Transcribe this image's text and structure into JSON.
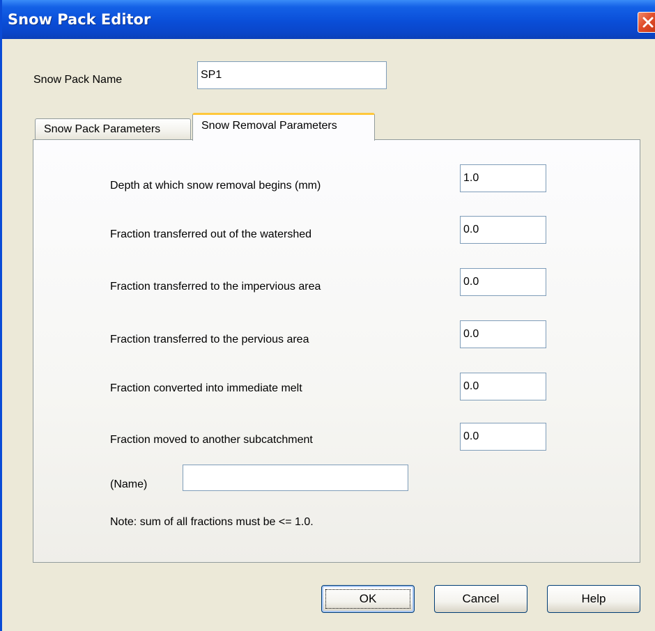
{
  "window": {
    "title": "Snow Pack Editor"
  },
  "snow_pack_name": {
    "label": "Snow Pack Name",
    "value": "SP1"
  },
  "tabs": [
    {
      "label": "Snow Pack Parameters",
      "active": false
    },
    {
      "label": "Snow Removal Parameters",
      "active": true
    }
  ],
  "removal": {
    "fields": [
      {
        "label": "Depth at which snow removal begins (mm)",
        "value": "1.0"
      },
      {
        "label": "Fraction transferred out of the watershed",
        "value": "0.0"
      },
      {
        "label": "Fraction transferred to the impervious area",
        "value": "0.0"
      },
      {
        "label": "Fraction transferred to the pervious area",
        "value": "0.0"
      },
      {
        "label": "Fraction converted into immediate melt",
        "value": "0.0"
      },
      {
        "label": "Fraction moved to another subcatchment",
        "value": "0.0"
      }
    ],
    "name_label": "(Name)",
    "name_value": "",
    "note": "Note: sum of all fractions must be <= 1.0."
  },
  "buttons": {
    "ok": "OK",
    "cancel": "Cancel",
    "help": "Help"
  },
  "icons": {
    "close": "close-icon"
  },
  "colors": {
    "titlebar": "#0a4ed8",
    "close": "#e04d2a",
    "active_tab_accent": "#ffc83c"
  }
}
